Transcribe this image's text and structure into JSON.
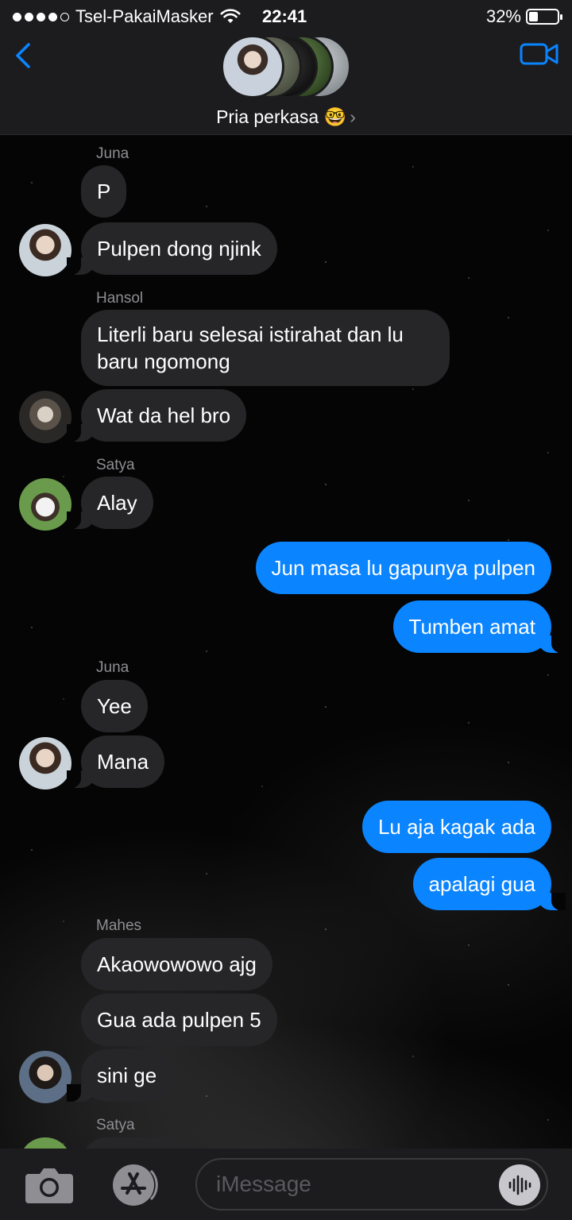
{
  "status_bar": {
    "carrier": "Tsel-PakaiMasker",
    "time": "22:41",
    "battery": "32%",
    "battery_level": 0.32,
    "signal_bars_filled": 4,
    "signal_bars_total": 5
  },
  "header": {
    "group_name": "Pria perkasa 🤓",
    "chevron": "›",
    "back_icon": "chevron-left-icon",
    "video_icon": "video-camera-icon",
    "accent_color": "#0a84ff"
  },
  "messages": [
    {
      "sender": "Juna",
      "text": "P",
      "direction": "incoming"
    },
    {
      "text": "Pulpen dong njink",
      "direction": "incoming",
      "avatar": true
    },
    {
      "sender": "Hansol",
      "text": "Literli baru selesai istirahat dan lu baru ngomong",
      "direction": "incoming"
    },
    {
      "text": "Wat da hel bro",
      "direction": "incoming",
      "avatar": true
    },
    {
      "sender": "Satya",
      "text": "Alay",
      "direction": "incoming",
      "avatar": true
    },
    {
      "text": "Jun masa lu gapunya pulpen",
      "direction": "outgoing"
    },
    {
      "text": "Tumben amat",
      "direction": "outgoing"
    },
    {
      "sender": "Juna",
      "text": "Yee",
      "direction": "incoming"
    },
    {
      "text": "Mana",
      "direction": "incoming",
      "avatar": true
    },
    {
      "text": "Lu aja kagak ada",
      "direction": "outgoing"
    },
    {
      "text": "apalagi gua",
      "direction": "outgoing"
    },
    {
      "sender": "Mahes",
      "text": "Akaowowowo ajg",
      "direction": "incoming"
    },
    {
      "text": "Gua ada pulpen 5",
      "direction": "incoming"
    },
    {
      "text": "sini ge",
      "direction": "incoming",
      "avatar": true
    },
    {
      "sender": "Satya",
      "text": "",
      "direction": "incoming"
    }
  ],
  "input_bar": {
    "placeholder": "iMessage",
    "camera_icon": "camera-icon",
    "appstore_icon": "app-store-icon",
    "audio_icon": "audio-waveform-icon"
  }
}
